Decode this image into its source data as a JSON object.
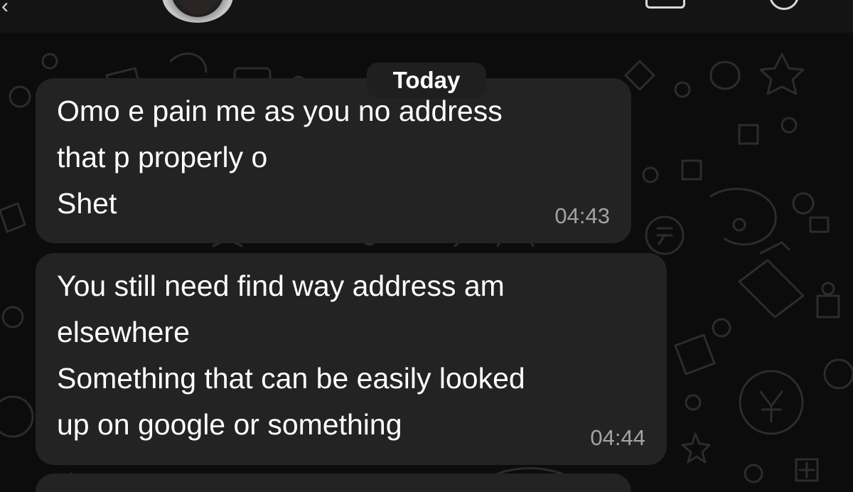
{
  "header": {
    "avatar_icon": "contact-avatar",
    "back_icon": "chevron-left-icon",
    "video_call_icon": "video-camera-icon",
    "voice_call_icon": "phone-icon"
  },
  "date_separator": "Today",
  "messages": [
    {
      "lines": [
        "Omo e pain me as you no address",
        "that p properly o",
        "Shet"
      ],
      "time": "04:43"
    },
    {
      "lines": [
        "You still need find way address am",
        "elsewhere",
        "Something that can be easily looked",
        "up on google or something"
      ],
      "time": "04:44"
    },
    {
      "lines": [],
      "time": ""
    }
  ],
  "colors": {
    "background": "#0c0c0c",
    "bubble": "#232323",
    "text": "#ffffff",
    "timestamp": "#a3a3a3"
  }
}
